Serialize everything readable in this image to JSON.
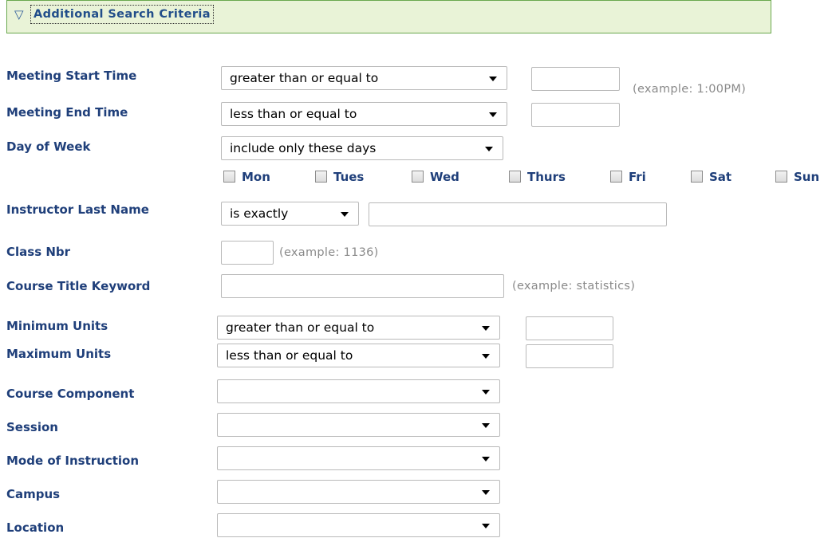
{
  "section": {
    "toggle_glyph": "▽",
    "title": "Additional Search Criteria"
  },
  "meeting_start": {
    "label": "Meeting Start Time",
    "operator": "greater than or equal to",
    "value": "",
    "hint": "(example: 1:00PM)"
  },
  "meeting_end": {
    "label": "Meeting End Time",
    "operator": "less than or equal to",
    "value": ""
  },
  "day_of_week": {
    "label": "Day of Week",
    "operator": "include only these days",
    "days": [
      {
        "label": "Mon",
        "checked": false
      },
      {
        "label": "Tues",
        "checked": false
      },
      {
        "label": "Wed",
        "checked": false
      },
      {
        "label": "Thurs",
        "checked": false
      },
      {
        "label": "Fri",
        "checked": false
      },
      {
        "label": "Sat",
        "checked": false
      },
      {
        "label": "Sun",
        "checked": false
      }
    ]
  },
  "instructor": {
    "label": "Instructor Last Name",
    "operator": "is exactly",
    "value": ""
  },
  "class_nbr": {
    "label": "Class Nbr",
    "value": "",
    "hint": "(example: 1136)"
  },
  "course_title": {
    "label": "Course Title Keyword",
    "value": "",
    "hint": "(example: statistics)"
  },
  "min_units": {
    "label": "Minimum Units",
    "operator": "greater than or equal to",
    "value": ""
  },
  "max_units": {
    "label": "Maximum Units",
    "operator": "less than or equal to",
    "value": ""
  },
  "course_component": {
    "label": "Course Component",
    "value": ""
  },
  "session": {
    "label": "Session",
    "value": ""
  },
  "mode_of_instruction": {
    "label": "Mode of Instruction",
    "value": ""
  },
  "campus": {
    "label": "Campus",
    "value": ""
  },
  "location": {
    "label": "Location",
    "value": ""
  }
}
